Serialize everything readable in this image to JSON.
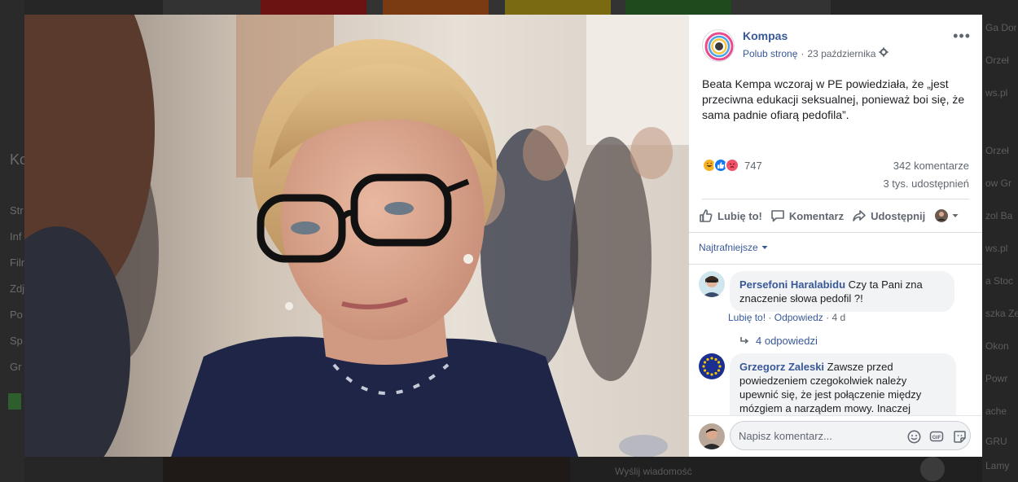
{
  "background": {
    "left_menu": [
      "Ko",
      "Str",
      "Inf",
      "Filr",
      "Zdj",
      "Po",
      "Sp",
      "Gr"
    ],
    "right_items": [
      "Ga Dor",
      "Orzeł",
      "ws.pl",
      "Orzeł",
      "ow Gr",
      "zol Ba",
      "ws.pl",
      "a Stoc",
      "szka Ze",
      "Okon",
      "Powr",
      "ache",
      "GRU",
      "Lamy"
    ],
    "bottom_message": "Wyślij wiadomość"
  },
  "post": {
    "page_name": "Kompas",
    "like_page": "Polub stronę",
    "separator": "·",
    "date": "23 października",
    "more": "•••",
    "text": "Beata Kempa wczoraj w PE powiedziała, że „jest przeciwna edukacji seksualnej, ponieważ boi się, że sama padnie ofiarą pedofila”.",
    "reactions_count": "747",
    "reaction_icons": [
      "haha-icon",
      "like-icon",
      "angry-icon"
    ],
    "comments_count": "342 komentarze",
    "shares_count": "3 tys. udostępnień",
    "actions": {
      "like": "Lubię to!",
      "comment": "Komentarz",
      "share": "Udostępnij"
    },
    "sort": "Najtrafniejsze",
    "comments": [
      {
        "author": "Persefoni Haralabidu",
        "text": "Czy ta Pani zna znaczenie słowa pedofil ?!",
        "like": "Lubię to!",
        "reply": "Odpowiedz",
        "dot": "·",
        "age": "4 d",
        "replies": "4 odpowiedzi"
      },
      {
        "author": "Grzegorz Zaleski",
        "text": "Zawsze przed powiedzeniem czegokolwiek należy upewnić się, że jest połączenie między mózgiem a narządem mowy. Inaczej wydala się z siebie takie potworki"
      }
    ],
    "composer_placeholder": "Napisz komentarz..."
  },
  "colors": {
    "link": "#385898",
    "secondary": "#606770",
    "like_blue": "#1877f2",
    "angry": "#f25268",
    "haha": "#f7b125"
  }
}
